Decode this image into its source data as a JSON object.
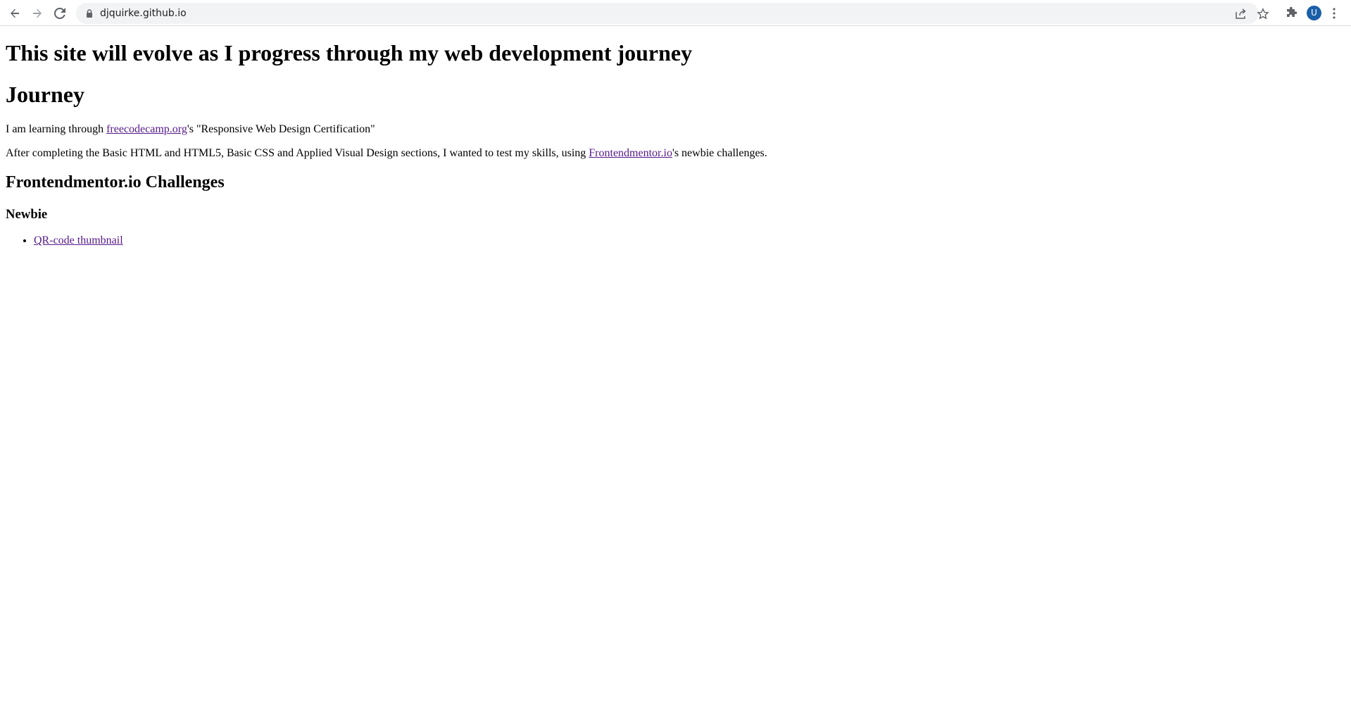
{
  "browser": {
    "url": "djquirke.github.io",
    "profile_initial": "U",
    "icons": {
      "back": "back-arrow-icon",
      "forward": "forward-arrow-icon",
      "reload": "reload-icon",
      "lock": "lock-icon",
      "share": "share-icon",
      "bookmark": "star-icon",
      "extensions": "puzzle-icon",
      "menu": "more-vert-icon"
    },
    "colors": {
      "toolbar_bg": "#ffffff",
      "omnibox_bg": "#f1f3f4",
      "avatar_bg": "#1a5fa8"
    }
  },
  "page": {
    "heading": "This site will evolve as I progress through my web development journey",
    "journey": {
      "title": "Journey",
      "para1": {
        "before": "I am learning through ",
        "link": "freecodecamp.org",
        "after": "'s \"Responsive Web Design Certification\""
      },
      "para2": {
        "before": "After completing the Basic HTML and HTML5, Basic CSS and Applied Visual Design sections, I wanted to test my skills, using ",
        "link": "Frontendmentor.io",
        "after": "'s newbie challenges."
      }
    },
    "challenges": {
      "title": "Frontendmentor.io Challenges",
      "newbie": {
        "title": "Newbie",
        "items": [
          {
            "label": "QR-code thumbnail"
          }
        ]
      }
    },
    "colors": {
      "visited_link": "#551a8b",
      "text": "#000000"
    }
  }
}
